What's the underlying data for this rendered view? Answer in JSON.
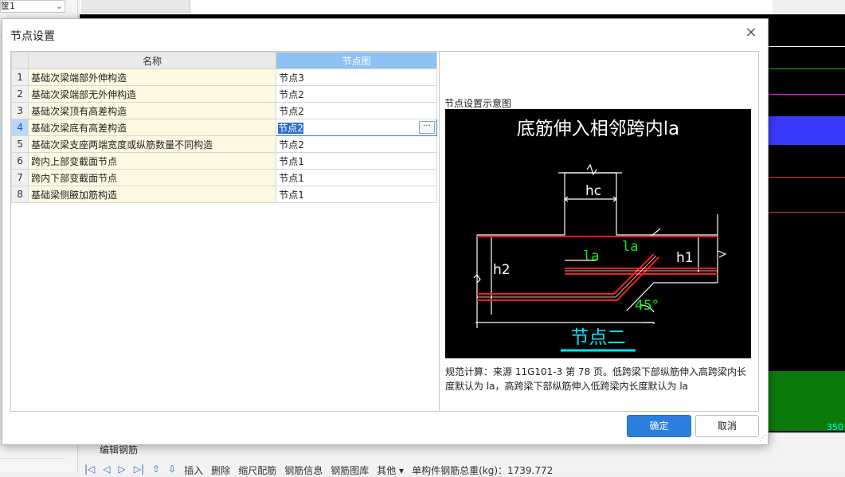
{
  "background": {
    "left_select_text": "筐1",
    "bottom_title": "编辑钢筋",
    "bottom_toolbar": [
      "插入",
      "删除",
      "缩尺配筋",
      "钢筋信息",
      "钢筋图库",
      "其他 ▾",
      "单构件钢筋总重(kg)：1739.772"
    ],
    "cad_number": "350"
  },
  "dialog": {
    "title": "节点设置",
    "close_glyph": "×",
    "columns": {
      "name": "名称",
      "node": "节点图"
    },
    "rows": [
      {
        "no": "1",
        "name": "基础次梁端部外伸构造",
        "node": "节点3"
      },
      {
        "no": "2",
        "name": "基础次梁端部无外伸构造",
        "node": "节点2"
      },
      {
        "no": "3",
        "name": "基础次梁顶有高差构造",
        "node": "节点2"
      },
      {
        "no": "4",
        "name": "基础次梁底有高差构造",
        "node": "节点2"
      },
      {
        "no": "5",
        "name": "基础次梁支座两端宽度或纵筋数量不同构造",
        "node": "节点2"
      },
      {
        "no": "6",
        "name": "跨内上部变截面节点",
        "node": "节点1"
      },
      {
        "no": "7",
        "name": "跨内下部变截面节点",
        "node": "节点1"
      },
      {
        "no": "8",
        "name": "基础梁侧腋加筋构造",
        "node": "节点1"
      }
    ],
    "selected_row": "4",
    "more_button": "···",
    "preview_label": "节点设置示意图",
    "diagram": {
      "title": "底筋伸入相邻跨内la",
      "hc": "hc",
      "h1": "h1",
      "h2": "h2",
      "la1": "la",
      "la2": "la",
      "angle": "45°",
      "node_label": "节点二"
    },
    "note": "规范计算：来源 11G101-3 第 78 页。低跨梁下部纵筋伸入高跨梁内长度默认为 la，高跨梁下部纵筋伸入低跨梁内长度默认为 la",
    "ok_label": "确定",
    "cancel_label": "取消"
  }
}
